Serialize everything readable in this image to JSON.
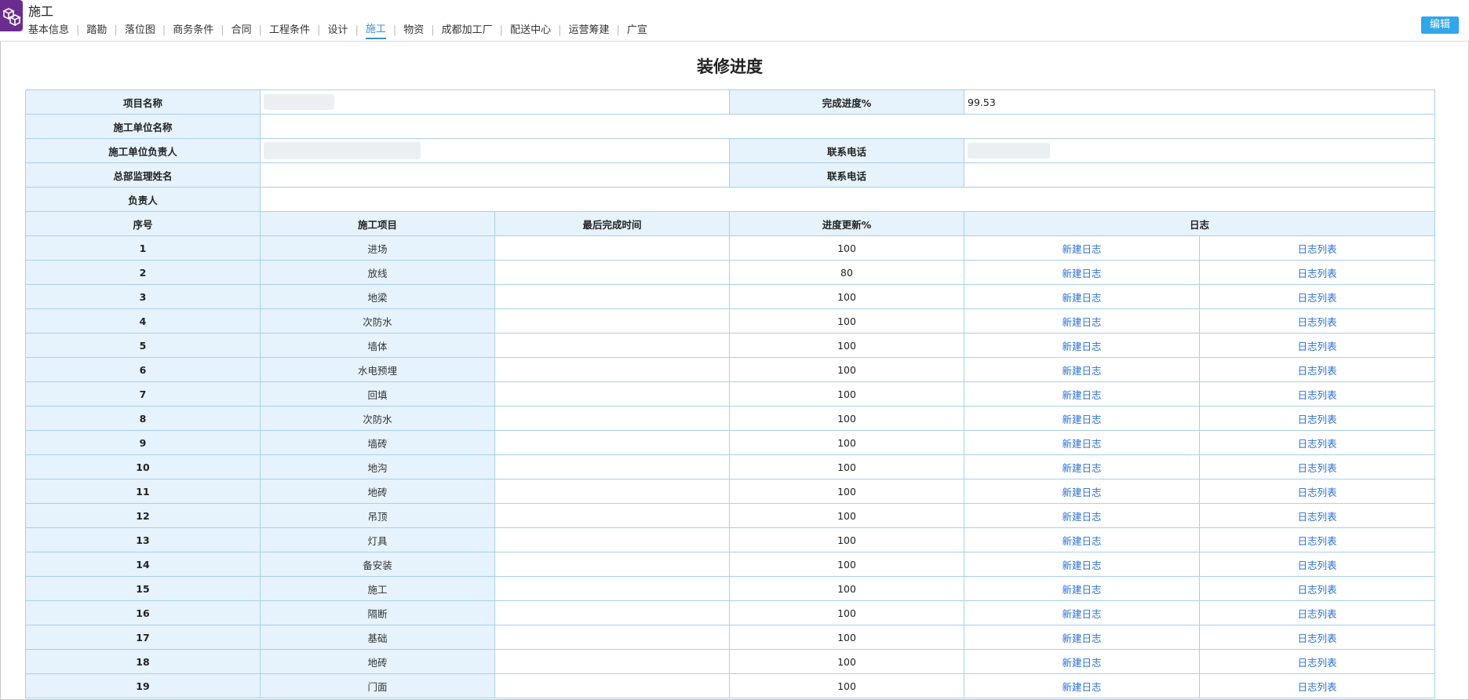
{
  "app": {
    "title": "施工"
  },
  "nav": [
    {
      "label": "基本信息",
      "active": false
    },
    {
      "label": "踏勘",
      "active": false
    },
    {
      "label": "落位图",
      "active": false
    },
    {
      "label": "商务条件",
      "active": false
    },
    {
      "label": "合同",
      "active": false
    },
    {
      "label": "工程条件",
      "active": false
    },
    {
      "label": "设计",
      "active": false
    },
    {
      "label": "施工",
      "active": true
    },
    {
      "label": "物资",
      "active": false
    },
    {
      "label": "成都加工厂",
      "active": false
    },
    {
      "label": "配送中心",
      "active": false
    },
    {
      "label": "运营筹建",
      "active": false
    },
    {
      "label": "广宣",
      "active": false
    }
  ],
  "edit_label": "编辑",
  "page_title": "装修进度",
  "info": {
    "project_name_label": "项目名称",
    "completion_label": "完成进度%",
    "completion_value": "99.53",
    "contractor_name_label": "施工单位名称",
    "contractor_lead_label": "施工单位负责人",
    "phone_label": "联系电话",
    "supervisor_label": "总部监理姓名",
    "owner_label": "负责人"
  },
  "columns": {
    "seq": "序号",
    "item": "施工项目",
    "last_time": "最后完成时间",
    "progress": "进度更新%",
    "log": "日志"
  },
  "new_log_label": "新建日志",
  "log_list_label": "日志列表",
  "rows": [
    {
      "seq": "1",
      "item": "进场",
      "progress": "100"
    },
    {
      "seq": "2",
      "item": "放线",
      "progress": "80"
    },
    {
      "seq": "3",
      "item": "地梁",
      "progress": "100"
    },
    {
      "seq": "4",
      "item": "次防水",
      "progress": "100"
    },
    {
      "seq": "5",
      "item": "墙体",
      "progress": "100"
    },
    {
      "seq": "6",
      "item": "水电预埋",
      "progress": "100"
    },
    {
      "seq": "7",
      "item": "回填",
      "progress": "100"
    },
    {
      "seq": "8",
      "item": "次防水",
      "progress": "100"
    },
    {
      "seq": "9",
      "item": "墙砖",
      "progress": "100"
    },
    {
      "seq": "10",
      "item": "地沟",
      "progress": "100"
    },
    {
      "seq": "11",
      "item": "地砖",
      "progress": "100"
    },
    {
      "seq": "12",
      "item": "吊顶",
      "progress": "100"
    },
    {
      "seq": "13",
      "item": "灯具",
      "progress": "100"
    },
    {
      "seq": "14",
      "item": "备安装",
      "progress": "100"
    },
    {
      "seq": "15",
      "item": "施工",
      "progress": "100"
    },
    {
      "seq": "16",
      "item": "隔断",
      "progress": "100"
    },
    {
      "seq": "17",
      "item": "基础",
      "progress": "100"
    },
    {
      "seq": "18",
      "item": "地砖",
      "progress": "100"
    },
    {
      "seq": "19",
      "item": "门面",
      "progress": "100"
    }
  ]
}
